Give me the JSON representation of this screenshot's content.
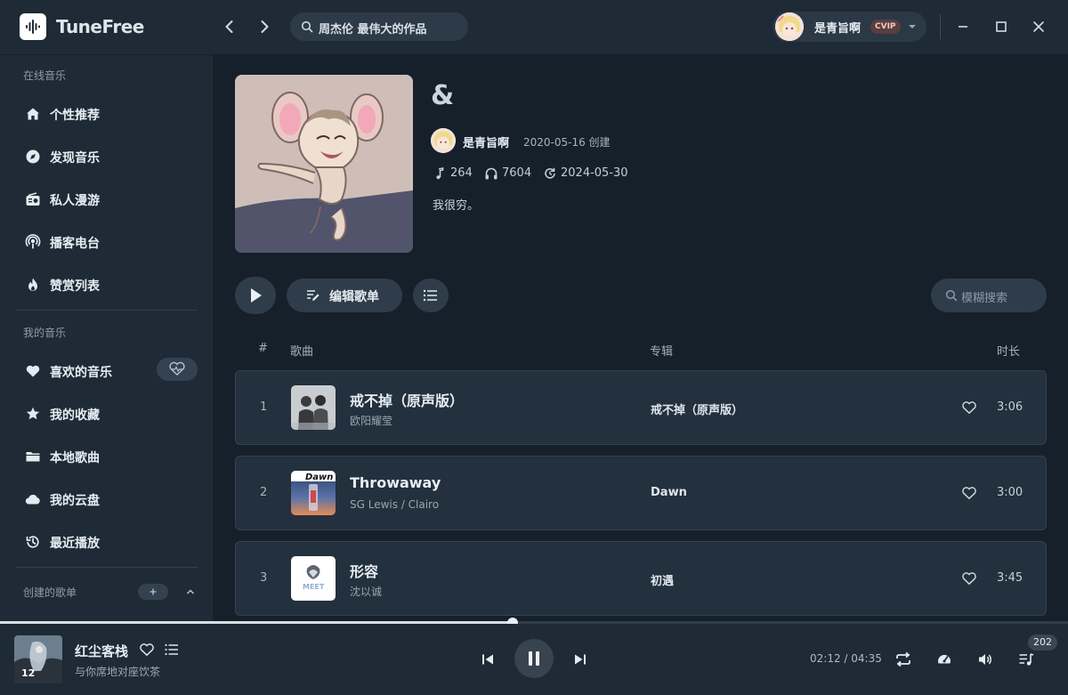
{
  "app": {
    "title": "TuneFree",
    "search_value": "周杰伦 最伟大的作品",
    "user": {
      "name": "是青旨啊",
      "vip": "CVIP"
    }
  },
  "sidebar": {
    "online_section": "在线音乐",
    "online_items": [
      {
        "label": "个性推荐",
        "icon": "home-icon"
      },
      {
        "label": "发现音乐",
        "icon": "disc-icon"
      },
      {
        "label": "私人漫游",
        "icon": "radio-icon"
      },
      {
        "label": "播客电台",
        "icon": "podcast-icon"
      },
      {
        "label": "赞赏列表",
        "icon": "flame-icon"
      }
    ],
    "my_section": "我的音乐",
    "my_items": [
      {
        "label": "喜欢的音乐",
        "icon": "heart-icon"
      },
      {
        "label": "我的收藏",
        "icon": "star-icon"
      },
      {
        "label": "本地歌曲",
        "icon": "folder-icon"
      },
      {
        "label": "我的云盘",
        "icon": "cloud-icon"
      },
      {
        "label": "最近播放",
        "icon": "history-icon"
      }
    ],
    "created_section": "创建的歌单"
  },
  "playlist": {
    "title": "&",
    "owner": "是青旨啊",
    "created": "2020-05-16 创建",
    "song_count": "264",
    "play_count": "7604",
    "updated": "2024-05-30",
    "description": "我很穷。",
    "edit_label": "编辑歌单",
    "search_placeholder": "模糊搜索"
  },
  "table": {
    "headers": {
      "num": "#",
      "song": "歌曲",
      "album": "专辑",
      "duration": "时长"
    },
    "rows": [
      {
        "num": "1",
        "title": "戒不掉（原声版）",
        "artist": "欧阳耀莹",
        "album": "戒不掉（原声版）",
        "duration": "3:06"
      },
      {
        "num": "2",
        "title": "Throwaway",
        "artist": "SG Lewis / Clairo",
        "album": "Dawn",
        "duration": "3:00",
        "cover_text": "Dawn"
      },
      {
        "num": "3",
        "title": "形容",
        "artist": "沈以诚",
        "album": "初遇",
        "duration": "3:45",
        "cover_text": "MEET"
      }
    ]
  },
  "player": {
    "title": "红尘客栈",
    "artist": "与你席地对座饮茶",
    "current_time": "02:12",
    "total_time": "04:35",
    "progress": 0.48,
    "queue_count": "202",
    "cover_text": "12"
  },
  "colors": {
    "background": "#15202b",
    "panel": "#1e2a36",
    "card": "#23303d",
    "text": "#e7eef4",
    "muted": "#9aa6b1"
  }
}
